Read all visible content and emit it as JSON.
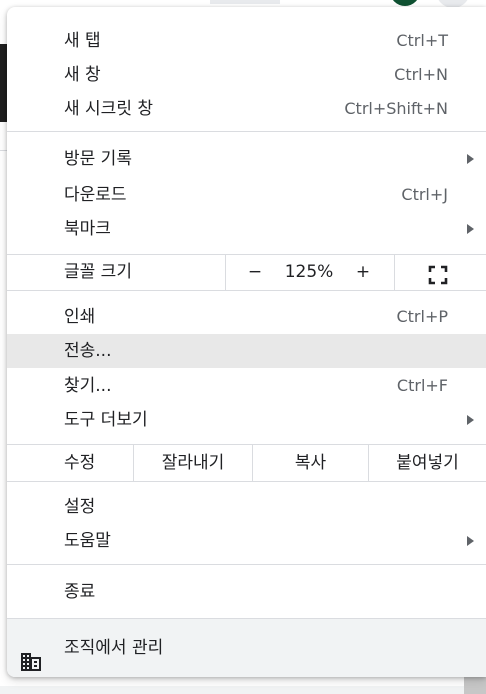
{
  "menu": {
    "items_top": [
      {
        "label": "새 탭",
        "shortcut": "Ctrl+T"
      },
      {
        "label": "새 창",
        "shortcut": "Ctrl+N"
      },
      {
        "label": "새 시크릿 창",
        "shortcut": "Ctrl+Shift+N"
      }
    ],
    "items_history": [
      {
        "label": "방문 기록",
        "submenu": true
      },
      {
        "label": "다운로드",
        "shortcut": "Ctrl+J"
      },
      {
        "label": "북마크",
        "submenu": true
      }
    ],
    "zoom": {
      "label": "글꼴 크기",
      "minus": "−",
      "level": "125%",
      "plus": "+",
      "fullscreen_icon": "fullscreen-icon"
    },
    "items_print": [
      {
        "label": "인쇄",
        "shortcut": "Ctrl+P"
      },
      {
        "label": "전송...",
        "highlighted": true
      },
      {
        "label": "찾기...",
        "shortcut": "Ctrl+F"
      },
      {
        "label": "도구 더보기",
        "submenu": true
      }
    ],
    "edit": {
      "label": "수정",
      "cut": "잘라내기",
      "copy": "복사",
      "paste": "붙여넣기"
    },
    "items_settings": [
      {
        "label": "설정"
      },
      {
        "label": "도움말",
        "submenu": true
      }
    ],
    "exit": {
      "label": "종료"
    },
    "managed": {
      "label": "조직에서 관리",
      "icon": "building-icon"
    }
  },
  "colors": {
    "hover": "#e8e8e8",
    "separator": "#dadce0",
    "shortcut_text": "#5f6368",
    "managed_bg": "#f1f3f4"
  }
}
